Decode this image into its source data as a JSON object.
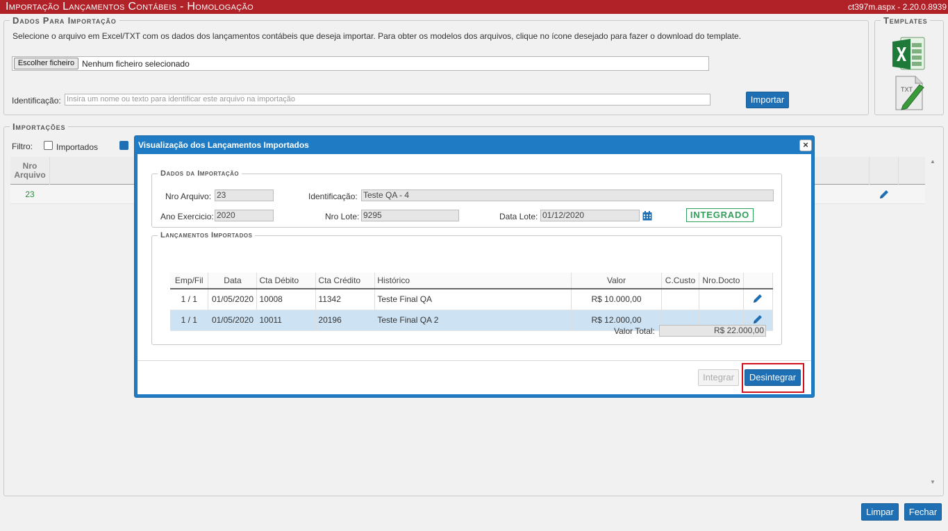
{
  "window": {
    "title": "Importação Lançamentos Contábeis  - Homologação",
    "page_info": "ct397m.aspx - 2.20.0.8939"
  },
  "dados_importacao": {
    "legend": "Dados Para Importação",
    "instructions": "Selecione o arquivo em Excel/TXT com os dados dos lançamentos contábeis que deseja importar. Para obter os modelos dos arquivos, clique no ícone desejado para fazer o download do template.",
    "file_button": "Escolher ficheiro",
    "file_status": "Nenhum ficheiro selecionado",
    "identificacao_label": "Identificação:",
    "identificacao_placeholder": "Insira um nome ou texto para identificar este arquivo na importação",
    "import_button": "Importar"
  },
  "templates": {
    "legend": "Templates",
    "excel_icon": "excel-icon",
    "txt_icon": "txt-file-icon",
    "txt_text": "TXT"
  },
  "importacoes": {
    "legend": "Importações",
    "filter_label": "Filtro:",
    "filter_importados": "Importados",
    "col_nro_arquivo": "Nro\nArquivo",
    "row_nro": "23"
  },
  "modal": {
    "title": "Visualização dos Lançamentos Importados",
    "close": "×",
    "dados": {
      "legend": "Dados da Importação",
      "nro_arquivo_label": "Nro Arquivo:",
      "nro_arquivo": "23",
      "identificacao_label": "Identificação:",
      "identificacao": "Teste QA - 4",
      "ano_label": "Ano Exercicio:",
      "ano": "2020",
      "nro_lote_label": "Nro Lote:",
      "nro_lote": "9295",
      "data_lote_label": "Data Lote:",
      "data_lote": "01/12/2020",
      "status": "INTEGRADO"
    },
    "lancamentos": {
      "legend": "Lançamentos Importados",
      "headers": [
        "Emp/Fil",
        "Data",
        "Cta Débito",
        "Cta Crédito",
        "Histórico",
        "Valor",
        "C.Custo",
        "Nro.Docto",
        ""
      ],
      "rows": [
        {
          "empfil": "1 / 1",
          "data": "01/05/2020",
          "debito": "10008",
          "credito": "11342",
          "historico": "Teste Final QA",
          "valor": "R$ 10.000,00",
          "ccusto": "",
          "docto": ""
        },
        {
          "empfil": "1 / 1",
          "data": "01/05/2020",
          "debito": "10011",
          "credito": "20196",
          "historico": "Teste Final QA 2",
          "valor": "R$ 12.000,00",
          "ccusto": "",
          "docto": ""
        }
      ],
      "total_label": "Valor Total:",
      "total": "R$ 22.000,00"
    },
    "integrar": "Integrar",
    "desintegrar": "Desintegrar"
  },
  "footer": {
    "limpar": "Limpar",
    "fechar": "Fechar"
  },
  "colors": {
    "titlebar": "#b02128",
    "accent_blue": "#1e6fb3",
    "status_green": "#2fa05a",
    "highlight_red": "#d0111b"
  }
}
